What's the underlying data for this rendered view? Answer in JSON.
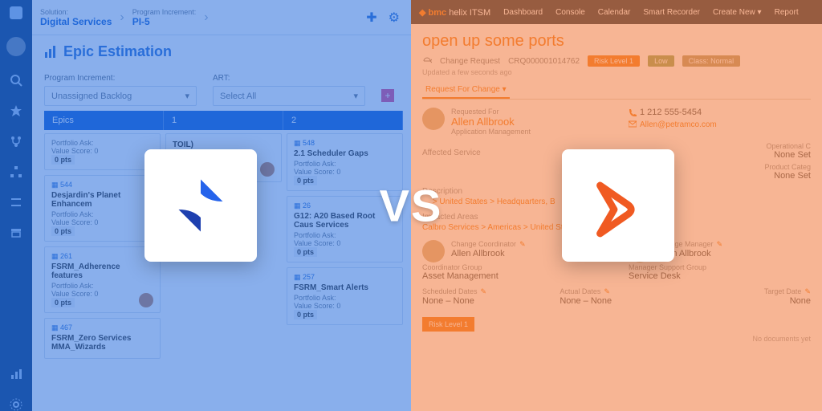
{
  "overlay": {
    "vs": "VS"
  },
  "left": {
    "breadcrumb": {
      "solution_label": "Solution:",
      "solution": "Digital Services",
      "pi_label": "Program Increment:",
      "pi": "PI-5"
    },
    "title": "Epic Estimation",
    "filters": {
      "pi_label": "Program Increment:",
      "pi_value": "Unassigned Backlog",
      "art_label": "ART:",
      "art_value": "Select All"
    },
    "columns": {
      "epics": "Epics",
      "one": "1",
      "two": "2"
    },
    "card_labels": {
      "pa": "Portfolio Ask:",
      "vs": "Value Score: 0",
      "pts": "0 pts"
    },
    "cards_col0": [
      {
        "id": "",
        "title": ""
      },
      {
        "id": "544",
        "title": "Desjardin's Planet Enhancem"
      },
      {
        "id": "261",
        "title": "FSRM_Adherence features"
      },
      {
        "id": "467",
        "title": "FSRM_Zero Services MMA_Wizards"
      }
    ],
    "cards_col1": [
      {
        "id": "",
        "title": "TOIL)"
      }
    ],
    "cards_col2": [
      {
        "id": "548",
        "title": "2.1 Scheduler Gaps"
      },
      {
        "id": "26",
        "title": "G12: A20 Based Root Caus Services"
      },
      {
        "id": "257",
        "title": "FSRM_Smart Alerts"
      }
    ]
  },
  "right": {
    "nav": {
      "brand": "bmc helix",
      "product": "ITSM",
      "items": [
        "Dashboard",
        "Console",
        "Calendar",
        "Smart Recorder",
        "Create New",
        "Report"
      ]
    },
    "title": "open up some ports",
    "type": "Change Request",
    "id": "CRQ000001014762",
    "badges": {
      "risk": "Risk Level 1",
      "low": "Low",
      "cls": "Class: Normal"
    },
    "updated": "Updated a few seconds ago",
    "tab": "Request For Change",
    "requester": {
      "label": "Requested For",
      "name": "Allen Allbrook",
      "dept": "Application Management",
      "phone": "1 212 555-5454",
      "email": "Allen@petramco.com"
    },
    "affected_label": "Affected Service",
    "operational_label": "Operational C",
    "operational_value": "None Set",
    "prodcat_label": "Product Categ",
    "prodcat_value": "None Set",
    "description_label": "Description",
    "location_crumb": "… > United States > Headquarters, B",
    "impacted_label": "Impacted Areas",
    "impacted_crumb": "Calbro Services > Americas > United States > …",
    "coord": {
      "role": "Change Coordinator",
      "name": "Allen Allbrook",
      "grp_l": "Coordinator Group",
      "grp": "Asset Management"
    },
    "mgr": {
      "role": "Change Manager",
      "name": "Allen Allbrook",
      "grp_l": "Manager Support Group",
      "grp": "Service Desk"
    },
    "sched": {
      "label": "Scheduled Dates",
      "value": "None – None"
    },
    "actual": {
      "label": "Actual Dates",
      "value": "None – None"
    },
    "target": {
      "label": "Target Date",
      "value": "None"
    },
    "risk_btn": "Risk Level 1",
    "nodocs": "No documents yet"
  }
}
